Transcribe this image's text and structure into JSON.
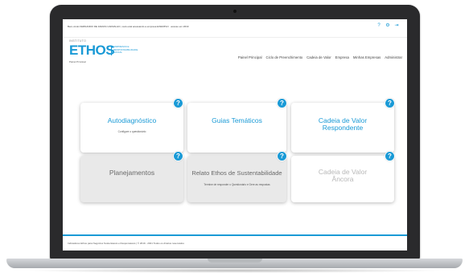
{
  "topbar": {
    "welcome": "Bem-vindo FERNANDO DE FARIAS CARVALHO, você está acessando a empresa EXEMPLO · acesso em 2019",
    "icons": [
      "help-icon",
      "settings-icon",
      "logout-icon"
    ]
  },
  "logo": {
    "pre": "INSTITUTO",
    "word": "ETHOS",
    "tagline": "EMPRESAS E RESPONSABILIDADE SOCIAL",
    "subtitle": "Painel Principal"
  },
  "nav": {
    "items": [
      "Painel Principal",
      "Ciclo de Preenchimento",
      "Cadeia de Valor",
      "Empresa",
      "Minhas Empresas",
      "Administrar"
    ]
  },
  "cards": [
    {
      "title": "Autodiagnóstico",
      "subtitle": "Configure o questionário"
    },
    {
      "title": "Guias Temáticos",
      "subtitle": ""
    },
    {
      "title": "Cadeia de Valor",
      "title2": "Respondente",
      "subtitle": ""
    },
    {
      "title": "Planejamentos",
      "subtitle": ""
    },
    {
      "title": "Relato Ethos de Sustentabilidade",
      "subtitle": "Termine de responder o Questionário e Gere as respostas"
    },
    {
      "title": "Cadeia de Valor",
      "title2": "Âncora",
      "subtitle": ""
    }
  ],
  "help_symbol": "?",
  "footer": {
    "text": "Indicadores Ethos para Negócios Sustentáveis e Responsáveis | © 2019 - 2021 Todos os direitos reservados"
  },
  "colors": {
    "accent": "#1a9ad6",
    "gray_card": "#e9e9e9"
  }
}
